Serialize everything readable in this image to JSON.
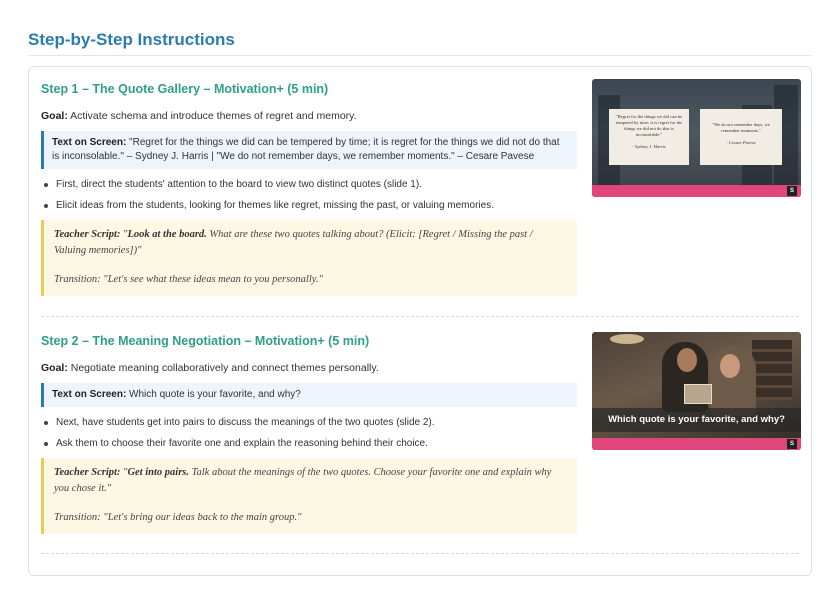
{
  "page": {
    "title": "Step-by-Step Instructions"
  },
  "steps": [
    {
      "heading": "Step 1 – The Quote Gallery – Motivation+ (5 min)",
      "goal_label": "Goal:",
      "goal": " Activate schema and introduce themes of regret and memory.",
      "screen_label": "Text on Screen:",
      "screen_text": " \"Regret for the things we did can be tempered by time; it is regret for the things we did not do that is inconsolable.\" – Sydney J. Harris | \"We do not remember days, we remember moments.\" – Cesare Pavese",
      "bullets": [
        "First, direct the students' attention to the board to view two distinct quotes (slide 1).",
        "Elicit ideas from the students, looking for themes like regret, missing the past, or valuing memories."
      ],
      "script_label": "Teacher Script:",
      "script_quote_open": " \"",
      "script_strong": "Look at the board.",
      "script_rest": " What are these two quotes talking about? (Elicit: [Regret / Missing the past / Valuing memories])\"",
      "transition": "Transition: \"Let's see what these ideas mean to you personally.\"",
      "slide": {
        "quote1": "\"Regret for the things we did can be tempered by time; it is regret for the things we did not do that is inconsolable.\"",
        "quote1_author": "- Sydney J. Harris",
        "quote2": "\"We do not remember days, we remember moments.\"",
        "quote2_author": "- Cesare Pavese"
      }
    },
    {
      "heading": "Step 2 – The Meaning Negotiation – Motivation+ (5 min)",
      "goal_label": "Goal:",
      "goal": " Negotiate meaning collaboratively and connect themes personally.",
      "screen_label": "Text on Screen:",
      "screen_text": " Which quote is your favorite, and why?",
      "bullets": [
        "Next, have students get into pairs to discuss the meanings of the two quotes (slide 2).",
        "Ask them to choose their favorite one and explain the reasoning behind their choice."
      ],
      "script_label": "Teacher Script:",
      "script_quote_open": " \"",
      "script_strong": "Get into pairs.",
      "script_rest": " Talk about the meanings of the two quotes. Choose your favorite one and explain why you chose it.\"",
      "transition": "Transition: \"Let's bring our ideas back to the main group.\"",
      "slide": {
        "caption": "Which quote is your favorite, and why?"
      }
    }
  ],
  "colors": {
    "title": "#2b7bb0",
    "heading": "#2f9e8a",
    "accent_pink": "#e0457b",
    "script_border": "#f2c94c"
  }
}
